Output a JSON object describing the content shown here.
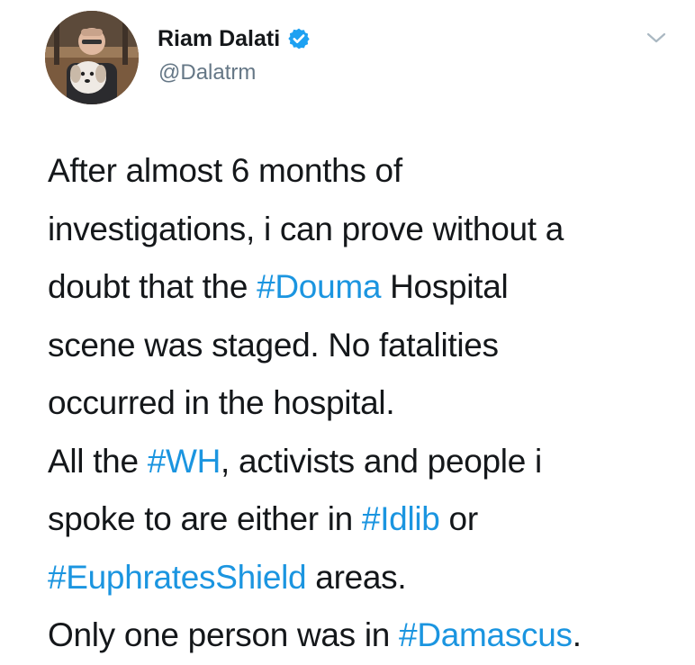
{
  "user": {
    "display_name": "Riam Dalati",
    "handle": "@Dalatrm",
    "verified": true
  },
  "tweet": {
    "lines": [
      [
        {
          "t": "After almost 6 months of"
        }
      ],
      [
        {
          "t": "investigations, i can prove without a"
        }
      ],
      [
        {
          "t": "doubt that the "
        },
        {
          "t": "#Douma",
          "tag": true
        },
        {
          "t": " Hospital"
        }
      ],
      [
        {
          "t": "scene was staged. No fatalities"
        }
      ],
      [
        {
          "t": "occurred in the hospital."
        }
      ],
      [
        {
          "t": "All the "
        },
        {
          "t": "#WH",
          "tag": true
        },
        {
          "t": ", activists and people i"
        }
      ],
      [
        {
          "t": "spoke to are either in "
        },
        {
          "t": "#Idlib",
          "tag": true
        },
        {
          "t": " or"
        }
      ],
      [
        {
          "t": "#EuphratesShield",
          "tag": true
        },
        {
          "t": " areas."
        }
      ],
      [
        {
          "t": "Only one person was in "
        },
        {
          "t": "#Damascus",
          "tag": true
        },
        {
          "t": "."
        }
      ]
    ]
  },
  "colors": {
    "text": "#14171a",
    "secondary": "#657786",
    "hashtag": "#1b95e0",
    "verified": "#1da1f2"
  },
  "icons": {
    "verified": "verified-badge-icon",
    "caret": "chevron-down-icon",
    "avatar": "profile-avatar"
  }
}
